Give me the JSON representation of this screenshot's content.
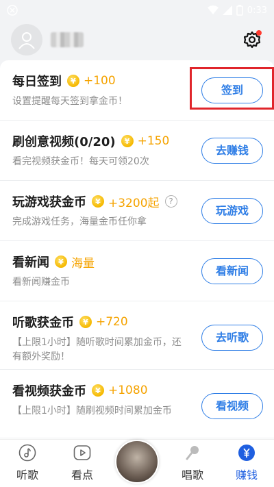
{
  "status_bar": {
    "time": "0:33"
  },
  "tasks": [
    {
      "title": "每日签到",
      "reward": "+100",
      "desc": "设置提醒每天签到拿金币！",
      "button": "签到",
      "has_help": false
    },
    {
      "title": "刷创意视频(0/20)",
      "reward": "+150",
      "desc": "看完视频获金币！每天可领20次",
      "button": "去赚钱",
      "has_help": false
    },
    {
      "title": "玩游戏获金币",
      "reward": "+3200起",
      "desc": "完成游戏任务，海量金币任你拿",
      "button": "玩游戏",
      "has_help": true
    },
    {
      "title": "看新闻",
      "reward": "海量",
      "desc": "看新闻赚金币",
      "button": "看新闻",
      "has_help": false
    },
    {
      "title": "听歌获金币",
      "reward": "+720",
      "desc": "【上限1小时】随听歌时间累加金币，还有额外奖励！",
      "button": "去听歌",
      "has_help": false
    },
    {
      "title": "看视频获金币",
      "reward": "+1080",
      "desc": "【上限1小时】随刷视频时间累加金币",
      "button": "看视频",
      "has_help": false
    }
  ],
  "coin_symbol": "¥",
  "help_symbol": "?",
  "tabs": [
    {
      "label": "听歌",
      "icon": "music-note-icon",
      "active": false
    },
    {
      "label": "看点",
      "icon": "play-icon",
      "active": false
    },
    {
      "label": "唱歌",
      "icon": "microphone-icon",
      "active": false
    },
    {
      "label": "赚钱",
      "icon": "yuan-icon",
      "active": true
    }
  ],
  "tab_active_symbol": "¥",
  "colors": {
    "accent": "#2f7ee6",
    "reward": "#f5a300",
    "active_tab": "#1f5fe0",
    "highlight": "#e0252b"
  }
}
